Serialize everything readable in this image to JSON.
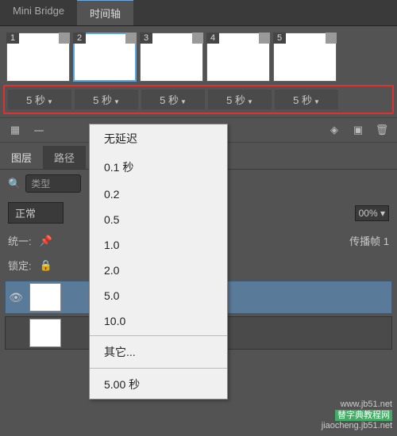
{
  "tabs": {
    "mini_bridge": "Mini Bridge",
    "timeline": "时间轴"
  },
  "frames": [
    {
      "num": "1",
      "delay": "5 秒"
    },
    {
      "num": "2",
      "delay": "5 秒"
    },
    {
      "num": "3",
      "delay": "5 秒"
    },
    {
      "num": "4",
      "delay": "5 秒"
    },
    {
      "num": "5",
      "delay": "5 秒"
    }
  ],
  "toolbar": {
    "loop": "一"
  },
  "menu": {
    "items": [
      "无延迟",
      "0.1 秒",
      "0.2",
      "0.5",
      "1.0",
      "2.0",
      "5.0",
      "10.0"
    ],
    "other": "其它...",
    "current": "5.00 秒"
  },
  "panels": {
    "layers_tab": "图层",
    "paths_tab": "路径",
    "search_label": "类型",
    "blend": "正常",
    "opacity": "00%",
    "unify_label": "统一:",
    "propagate": "传播帧 1",
    "lock_label": "锁定:"
  },
  "watermark": {
    "line1": "替字典教程网",
    "line2": "jiaocheng.jb51.net",
    "corner": "www.jb51.net"
  }
}
